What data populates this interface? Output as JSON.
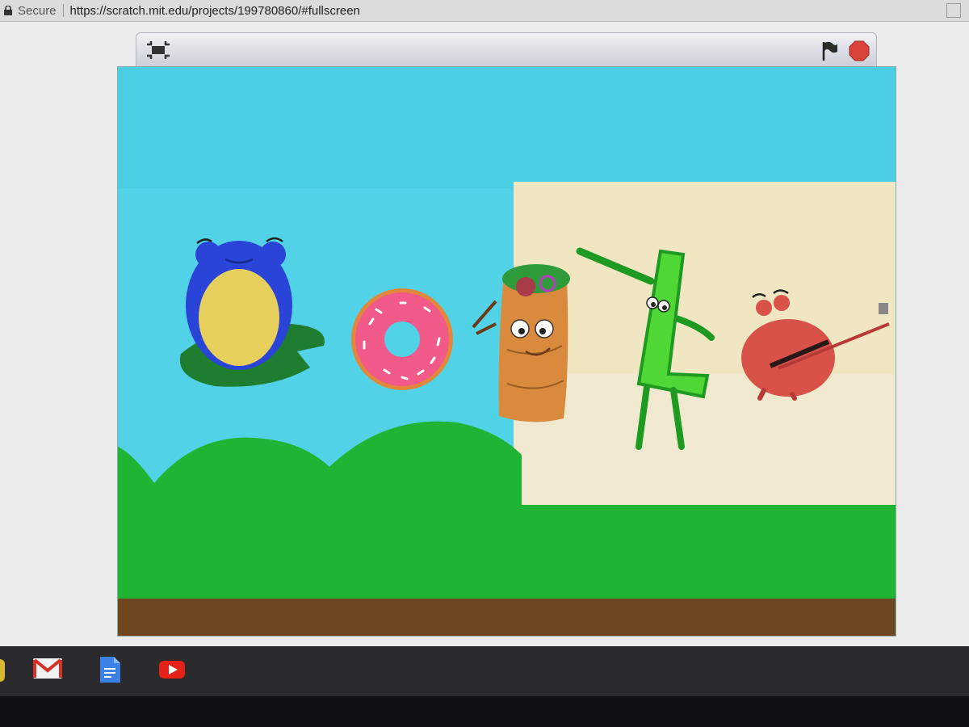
{
  "browser": {
    "secure_label": "Secure",
    "url": "https://scratch.mit.edu/projects/199780860/#fullscreen"
  },
  "colors": {
    "sky": "#51d4e8",
    "grass": "#1fb434",
    "dirt": "#6e4620",
    "paper": "#f0e6c0",
    "frog_blue": "#2a44d8",
    "crab_red": "#d8524a"
  },
  "icons": {
    "exit_fullscreen": "exit-fullscreen-icon",
    "green_flag": "green-flag-icon",
    "stop": "stop-icon",
    "gmail": "gmail-icon",
    "docs": "docs-icon",
    "youtube": "youtube-icon"
  }
}
